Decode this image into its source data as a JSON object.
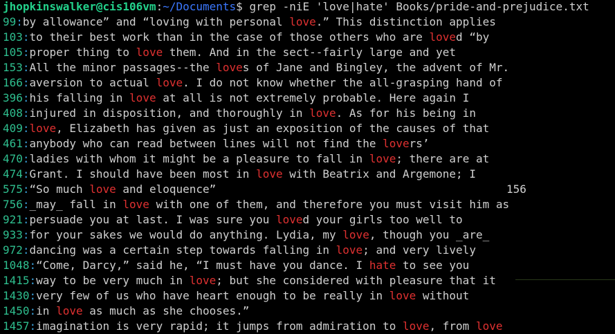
{
  "prompt": {
    "user_host": "jhopkinswalker@cis106vm",
    "separator": ":",
    "cwd": "~/Documents",
    "symbol": "$",
    "command": " grep -niE 'love|hate' Books/pride-and-prejudice.txt"
  },
  "results": [
    {
      "n": "99",
      "parts": [
        {
          "t": "by allowance” and “loving with personal "
        },
        {
          "t": "love",
          "m": true
        },
        {
          "t": ".” This distinction applies"
        }
      ]
    },
    {
      "n": "103",
      "parts": [
        {
          "t": "to their best work than in the case of those others who are "
        },
        {
          "t": "love",
          "m": true
        },
        {
          "t": "d “by"
        }
      ]
    },
    {
      "n": "105",
      "parts": [
        {
          "t": "proper thing to "
        },
        {
          "t": "love",
          "m": true
        },
        {
          "t": " them. And in the sect--fairly large and yet"
        }
      ]
    },
    {
      "n": "153",
      "parts": [
        {
          "t": "All the minor passages--the "
        },
        {
          "t": "love",
          "m": true
        },
        {
          "t": "s of Jane and Bingley, the advent of Mr."
        }
      ]
    },
    {
      "n": "166",
      "parts": [
        {
          "t": "aversion to actual "
        },
        {
          "t": "love",
          "m": true
        },
        {
          "t": ". I do not know whether the all-grasping hand of"
        }
      ]
    },
    {
      "n": "396",
      "parts": [
        {
          "t": "his falling in "
        },
        {
          "t": "love",
          "m": true
        },
        {
          "t": " at all is not extremely probable. Here again I"
        }
      ]
    },
    {
      "n": "408",
      "parts": [
        {
          "t": "injured in disposition, and thoroughly in "
        },
        {
          "t": "love",
          "m": true
        },
        {
          "t": ". As for his being in"
        }
      ]
    },
    {
      "n": "409",
      "parts": [
        {
          "t": "love",
          "m": true
        },
        {
          "t": ", Elizabeth has given as just an exposition of the causes of that"
        }
      ]
    },
    {
      "n": "461",
      "parts": [
        {
          "t": "anybody who can read between lines will not find the "
        },
        {
          "t": "love",
          "m": true
        },
        {
          "t": "rs’"
        }
      ]
    },
    {
      "n": "470",
      "parts": [
        {
          "t": "ladies with whom it might be a pleasure to fall in "
        },
        {
          "t": "love",
          "m": true
        },
        {
          "t": "; there are at"
        }
      ]
    },
    {
      "n": "474",
      "parts": [
        {
          "t": "Grant. I should have been most in "
        },
        {
          "t": "love",
          "m": true
        },
        {
          "t": " with Beatrix and Argemone; I"
        }
      ]
    },
    {
      "n": "575",
      "parts": [
        {
          "t": "“So much "
        },
        {
          "t": "love",
          "m": true
        },
        {
          "t": " and eloquence”"
        }
      ],
      "page": "156"
    },
    {
      "n": "756",
      "parts": [
        {
          "t": "_may_ fall in "
        },
        {
          "t": "love",
          "m": true
        },
        {
          "t": " with one of them, and therefore you must visit him as"
        }
      ]
    },
    {
      "n": "921",
      "parts": [
        {
          "t": "persuade you at last. I was sure you "
        },
        {
          "t": "love",
          "m": true
        },
        {
          "t": "d your girls too well to"
        }
      ]
    },
    {
      "n": "933",
      "parts": [
        {
          "t": "for your sakes we would do anything. Lydia, my "
        },
        {
          "t": "love",
          "m": true
        },
        {
          "t": ", though you _are_"
        }
      ]
    },
    {
      "n": "972",
      "parts": [
        {
          "t": "dancing was a certain step towards falling in "
        },
        {
          "t": "love",
          "m": true
        },
        {
          "t": "; and very lively"
        }
      ]
    },
    {
      "n": "1048",
      "parts": [
        {
          "t": "“Come, Darcy,” said he, “I must have you dance. I "
        },
        {
          "t": "hate",
          "m": true
        },
        {
          "t": " to see you"
        }
      ]
    },
    {
      "n": "1415",
      "parts": [
        {
          "t": "way to be very much in "
        },
        {
          "t": "love",
          "m": true
        },
        {
          "t": "; but she considered with pleasure that it"
        }
      ]
    },
    {
      "n": "1430",
      "parts": [
        {
          "t": "very few of us who have heart enough to be really in "
        },
        {
          "t": "love",
          "m": true
        },
        {
          "t": " without"
        }
      ]
    },
    {
      "n": "1450",
      "parts": [
        {
          "t": "in "
        },
        {
          "t": "love",
          "m": true
        },
        {
          "t": " as much as she chooses.”"
        }
      ]
    },
    {
      "n": "1457",
      "parts": [
        {
          "t": "imagination is very rapid; it jumps from admiration to "
        },
        {
          "t": "love",
          "m": true
        },
        {
          "t": ", from "
        },
        {
          "t": "love",
          "m": true
        }
      ]
    }
  ],
  "colors": {
    "background": "#000000",
    "text": "#d0d0d0",
    "user_host": "#23d18b",
    "path": "#3b78ff",
    "line_number": "#2fbf8f",
    "match": "#e03131"
  }
}
